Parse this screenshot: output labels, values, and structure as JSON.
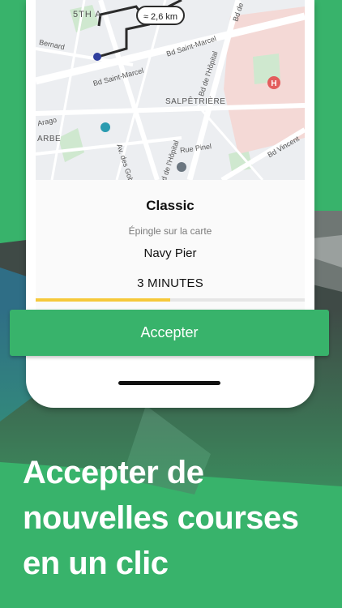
{
  "map": {
    "distance_label": "≈ 2,6 km",
    "labels": {
      "district_5th": "5TH A",
      "bernard": "Bernard",
      "bd_saint_marcel_1": "Bd Saint-Marcel",
      "bd_saint_marcel_2": "Bd Saint-Marcel",
      "bd_de_lhopital_1": "Bd de l'Hôpital",
      "bd_de_lhopital_2": "Bd de l'Hôpital",
      "bd_de": "Bd de",
      "salpetriere": "SALPÊTRIÈRE",
      "arago": "Arago",
      "arbe": "ARBE",
      "av_des_gob": "Av. des Gob",
      "rue_pinel": "Rue Pinel",
      "bd_vincent": "Bd Vincent"
    },
    "colors": {
      "route": "#2b2b2b",
      "origin_dot": "#2f3f9e",
      "hospital": "#e35d5d"
    }
  },
  "ride": {
    "type": "Classic",
    "pickup_hint": "Épingle sur la carte",
    "place": "Navy Pier",
    "eta": "3 MINUTES",
    "progress_fraction": 0.5
  },
  "accept_button": {
    "label": "Accepter"
  },
  "headline": {
    "line1": "Accepter de",
    "line2": "nouvelles courses",
    "line3": "en un clic"
  },
  "colors": {
    "brand_green": "#38b36b",
    "progress_yellow": "#f6c93b"
  }
}
